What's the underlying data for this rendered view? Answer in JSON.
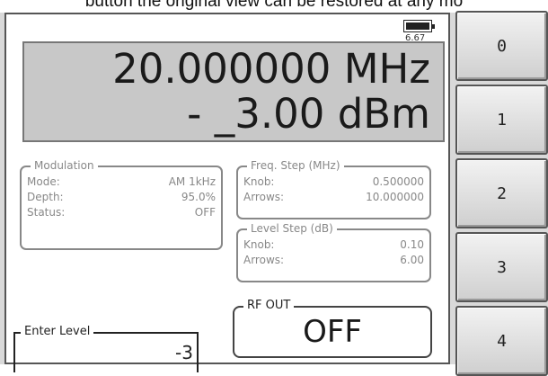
{
  "caption": "button the original view can be restored at any mo",
  "status": {
    "battery_voltage": "6.67",
    "battery_icon": "battery-icon"
  },
  "readout": {
    "frequency": "20.000000 MHz",
    "level": "- _3.00 dBm"
  },
  "modulation": {
    "title": "Modulation",
    "rows": [
      {
        "key": "Mode:",
        "value": "AM 1kHz"
      },
      {
        "key": "Depth:",
        "value": "95.0%"
      },
      {
        "key": "Status:",
        "value": "OFF"
      }
    ]
  },
  "freq_step": {
    "title": "Freq. Step (MHz)",
    "rows": [
      {
        "key": "Knob:",
        "value": "0.500000"
      },
      {
        "key": "Arrows:",
        "value": "10.000000"
      }
    ]
  },
  "level_step": {
    "title": "Level Step (dB)",
    "rows": [
      {
        "key": "Knob:",
        "value": "0.10"
      },
      {
        "key": "Arrows:",
        "value": "6.00"
      }
    ]
  },
  "rf_out": {
    "title": "RF OUT",
    "state": "OFF"
  },
  "enter_level": {
    "title": "Enter Level",
    "value": "-3"
  },
  "keypad": {
    "keys": [
      "0",
      "1",
      "2",
      "3",
      "4"
    ]
  }
}
